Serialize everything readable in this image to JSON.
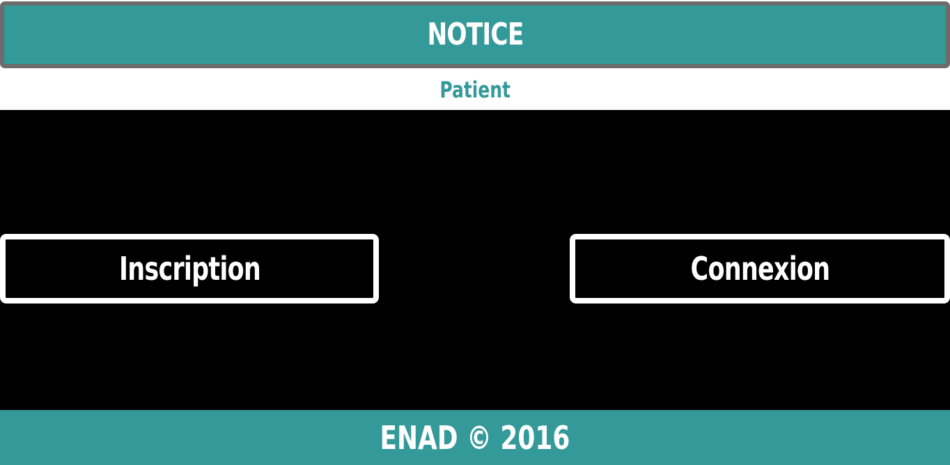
{
  "header": {
    "title": "NOTICE"
  },
  "subtitle": {
    "text": "Patient"
  },
  "actions": {
    "register_label": "Inscription",
    "login_label": "Connexion"
  },
  "footer": {
    "text": "ENAD © 2016"
  },
  "colors": {
    "accent": "#339a99",
    "header_border": "#6c6c6c",
    "main_background": "#000000",
    "button_border": "#ffffff"
  }
}
